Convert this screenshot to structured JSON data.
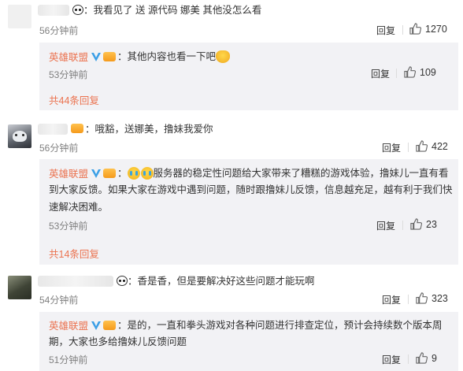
{
  "labels": {
    "reply": "回复",
    "weibo": "英雄联盟"
  },
  "comments": [
    {
      "text": "：我看见了 送 源代码 娜美  其他没怎么看",
      "time": "56分钟前",
      "likes": "1270",
      "reply": {
        "text": "：其他内容也看一下吧",
        "time": "53分钟前",
        "likes": "109"
      },
      "more": "共44条回复"
    },
    {
      "text": "：哦豁，送娜美，撸妹我爱你",
      "time": "56分钟前",
      "likes": "422",
      "reply": {
        "text_line1": "服务器的稳定性问题给大家带来了糟糕的游戏体验，撸妹儿一直有看",
        "text_line2": "到大家反馈。如果大家在游戏中遇到问题，随时跟撸妹儿反馈，信息越充足，越有利于我们快",
        "text_line3": "速解决困难。",
        "time": "53分钟前",
        "likes": "23"
      },
      "more": "共14条回复"
    },
    {
      "text": "：香是香，但是要解决好这些问题才能玩啊",
      "time": "54分钟前",
      "likes": "323",
      "reply": {
        "text_line1": "：是的，一直和拳头游戏对各种问题进行排查定位，预计会持续数个版本周",
        "text_line2": "期，大家也多给撸妹儿反馈问题",
        "time": "51分钟前",
        "likes": "9"
      }
    }
  ],
  "colors": {
    "name": "#eb7350",
    "reply_bg": "#f2f2f5",
    "badge_blue": "#3b9fe6"
  }
}
